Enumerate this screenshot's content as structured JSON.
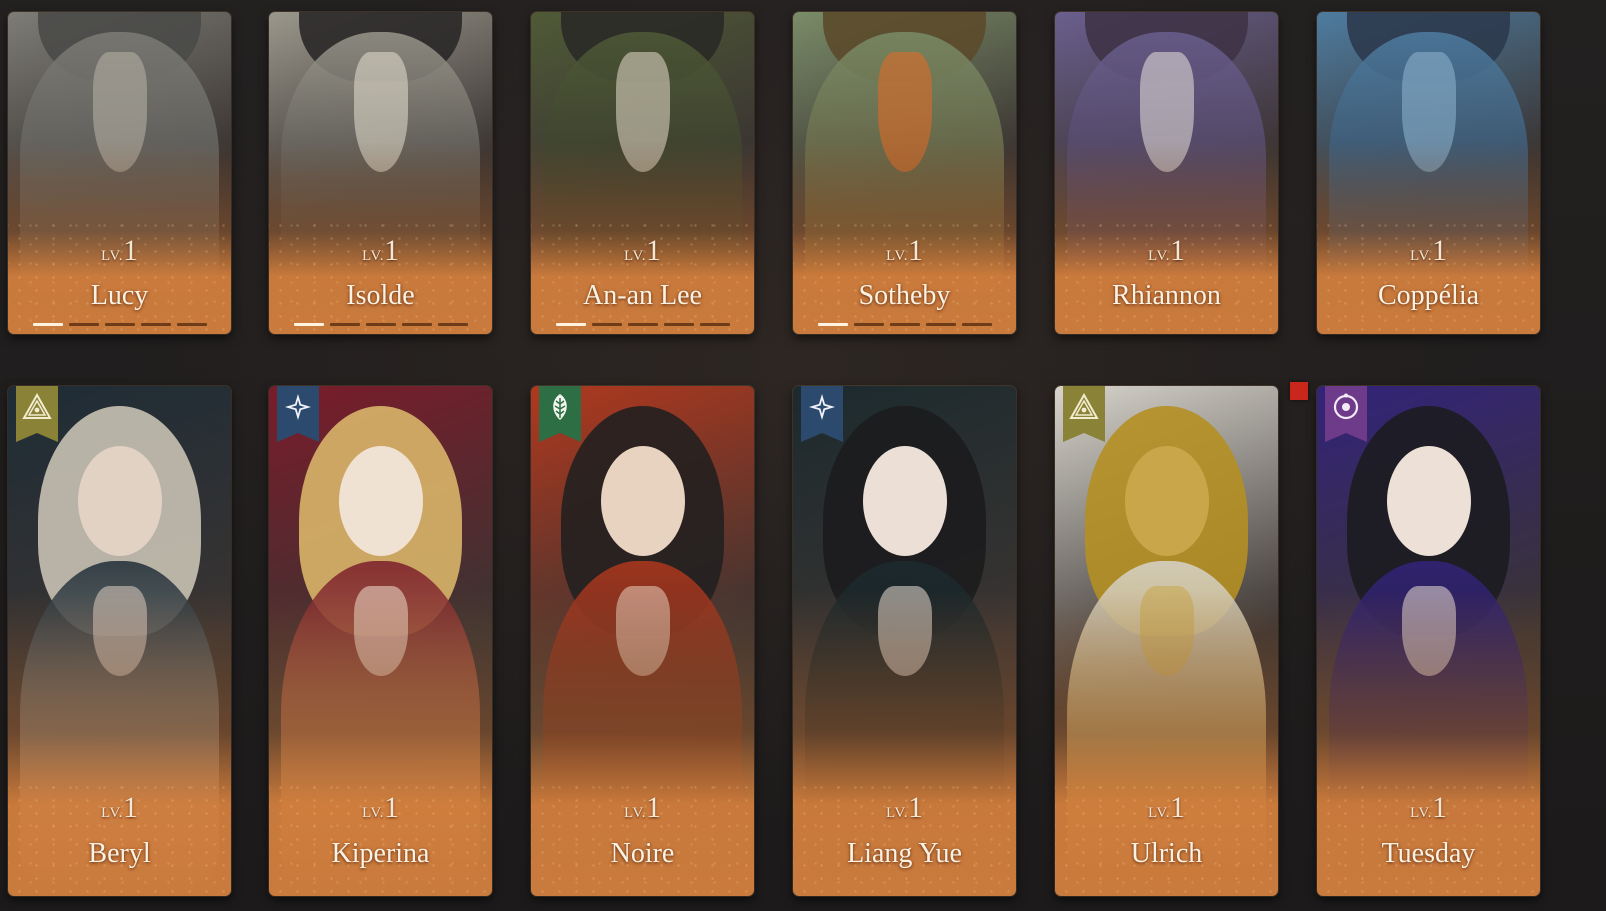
{
  "level_label": "LV.",
  "top_row": [
    {
      "name": "Lucy",
      "level": "1",
      "progress_filled": 1,
      "progress_total": 5,
      "palette": [
        "#7d7c76",
        "#4a4a48",
        "#b9b4a8"
      ]
    },
    {
      "name": "Isolde",
      "level": "1",
      "progress_filled": 1,
      "progress_total": 5,
      "palette": [
        "#9a978c",
        "#2a2828",
        "#e6e0d0"
      ]
    },
    {
      "name": "An-an Lee",
      "level": "1",
      "progress_filled": 1,
      "progress_total": 5,
      "palette": [
        "#4f5a36",
        "#2a2a26",
        "#e8ddcc"
      ]
    },
    {
      "name": "Sotheby",
      "level": "1",
      "progress_filled": 1,
      "progress_total": 5,
      "palette": [
        "#7a8c68",
        "#5b4a2a",
        "#e86a22"
      ]
    },
    {
      "name": "Rhiannon",
      "level": "1",
      "progress_filled": 0,
      "progress_total": 0,
      "palette": [
        "#6a5f8e",
        "#3e3346",
        "#e9e3dc"
      ]
    },
    {
      "name": "Coppélia",
      "level": "1",
      "progress_filled": 0,
      "progress_total": 0,
      "palette": [
        "#4e7ca0",
        "#2c3a4e",
        "#8fb6d2"
      ]
    }
  ],
  "bottom_row": [
    {
      "name": "Beryl",
      "level": "1",
      "badge": "eye-triangle",
      "badge_color": "#8a8236",
      "palette": [
        "#1e2c36",
        "#c9c2b4",
        "#e2d2c4"
      ]
    },
    {
      "name": "Kiperina",
      "level": "1",
      "badge": "star",
      "badge_color": "#2c4a6e",
      "palette": [
        "#7a1c2a",
        "#d9b56a",
        "#f0e2d2"
      ]
    },
    {
      "name": "Noire",
      "level": "1",
      "badge": "leaf",
      "badge_color": "#2e6e44",
      "palette": [
        "#b0381e",
        "#222020",
        "#e8d2c0"
      ]
    },
    {
      "name": "Liang Yue",
      "level": "1",
      "badge": "star",
      "badge_color": "#2c4a6e",
      "palette": [
        "#1c2a2e",
        "#1c1c1e",
        "#ece0d6"
      ]
    },
    {
      "name": "Ulrich",
      "level": "1",
      "badge": "eye-triangle",
      "badge_color": "#8a8236",
      "palette": [
        "#d7d4cc",
        "#b48f22",
        "#c9a64a"
      ],
      "new": true
    },
    {
      "name": "Tuesday",
      "level": "1",
      "badge": "moon-ring",
      "badge_color": "#6e3a8a",
      "palette": [
        "#33237a",
        "#1c1c20",
        "#ede0d6"
      ]
    }
  ]
}
